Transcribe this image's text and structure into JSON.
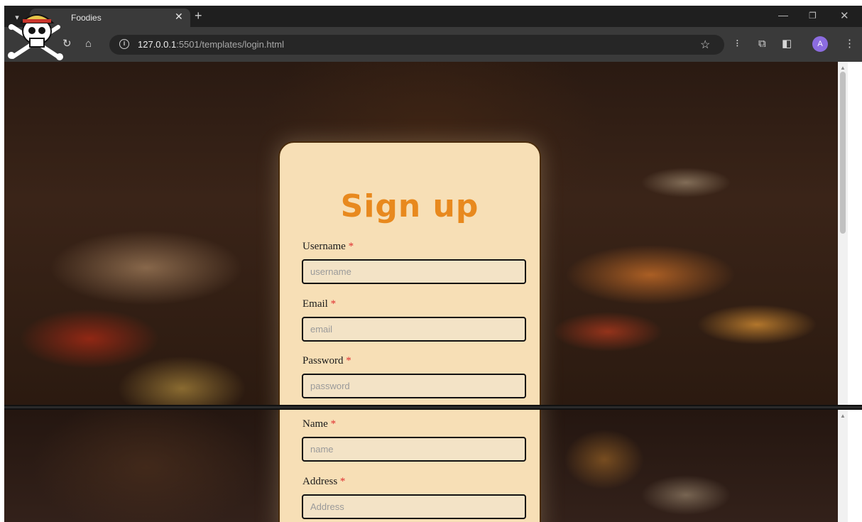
{
  "browser": {
    "tab_title": "Foodies",
    "tab_close": "✕",
    "new_tab": "+",
    "url_host": "127.0.0.1",
    "url_rest": ":5501/templates/login.html",
    "avatar_letter": "A"
  },
  "signup": {
    "title": "Sign up",
    "required_mark": "*",
    "fields": [
      {
        "label": "Username",
        "placeholder": "username"
      },
      {
        "label": "Email",
        "placeholder": "email"
      },
      {
        "label": "Password",
        "placeholder": "password"
      },
      {
        "label": "Name",
        "placeholder": "name"
      },
      {
        "label": "Address",
        "placeholder": "Address"
      }
    ]
  },
  "colors": {
    "card_bg": "#f7dfb6",
    "title": "#e8891e",
    "required": "#e03030",
    "avatar": "#8c6ce0"
  }
}
